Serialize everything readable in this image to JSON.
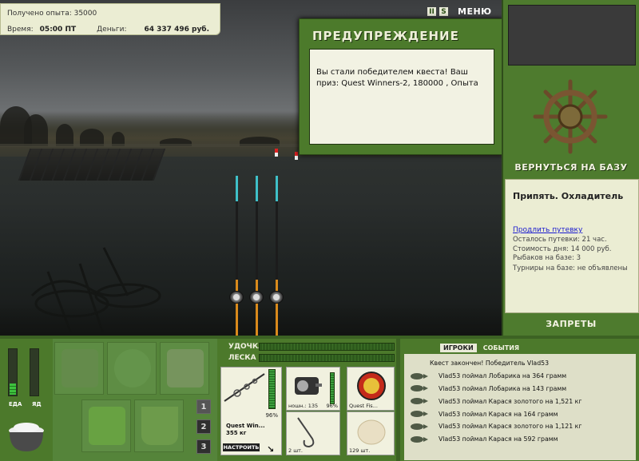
{
  "info": {
    "experience_label": "Получено опыта: 35000",
    "time_label": "Время:",
    "time_value": "05:00 ПТ",
    "money_label": "Деньги:",
    "money_value": "64 337 496 руб."
  },
  "topbar": {
    "pause_label": "II",
    "sound_label": "S",
    "menu_label": "МЕНЮ"
  },
  "warning": {
    "title": "ПРЕДУПРЕЖДЕНИЕ",
    "message": "Вы стали победителем квеста! Ваш приз: Quest Winners-2, 180000 , Опыта"
  },
  "right_panel": {
    "return_label": "ВЕРНУТЬСЯ НА БАЗУ",
    "location_name": "Припять. Охладитель",
    "extend_link": "Продлить путевку",
    "remaining": "Осталось путевки: 21 час.",
    "day_cost": "Стоимость дня: 14 000 руб.",
    "anglers": "Рыбаков на базе: 3",
    "tournaments": "Турниры на базе: не объявлены",
    "bans_label": "ЗАПРЕТЫ"
  },
  "meters": {
    "food_label": "ЕДА",
    "poison_label": "ЯД",
    "food_level": 0.25,
    "poison_level": 0.0
  },
  "inventory": {
    "tabs": [
      "1",
      "2",
      "3"
    ],
    "active_tab": "1"
  },
  "tackle": {
    "rod_label": "УДОЧКА",
    "line_label": "ЛЕСКА",
    "rod_name": "Quest Win...",
    "rod_weight": "355 кг",
    "rod_condition": "96%",
    "setup_label": "НАСТРОИТЬ",
    "reel_caption": "ношн.: 135",
    "reel_condition": "96%",
    "bait_name": "Quest Fis...",
    "hook_count": "2 шт.",
    "groundbait_count": "129 шт."
  },
  "log": {
    "tab_players": "ИГРОКИ",
    "tab_events": "СОБЫТИЯ",
    "first_line": "Квест закончен! Победитель Vlad53",
    "entries": [
      "Vlad53 поймал Лобарика на 364 грамм",
      "Vlad53 поймал Лобарика на 143 грамм",
      "Vlad53 поймал Карася золотого на 1,521 кг",
      "Vlad53 поймал Карася на 164 грамм",
      "Vlad53 поймал Карася золотого на 1,121 кг",
      "Vlad53 поймал Карася на 592 грамм"
    ]
  },
  "colors": {
    "panel_green": "#4c792b",
    "cream": "#ebedd3",
    "link_blue": "#1a1ad0"
  }
}
